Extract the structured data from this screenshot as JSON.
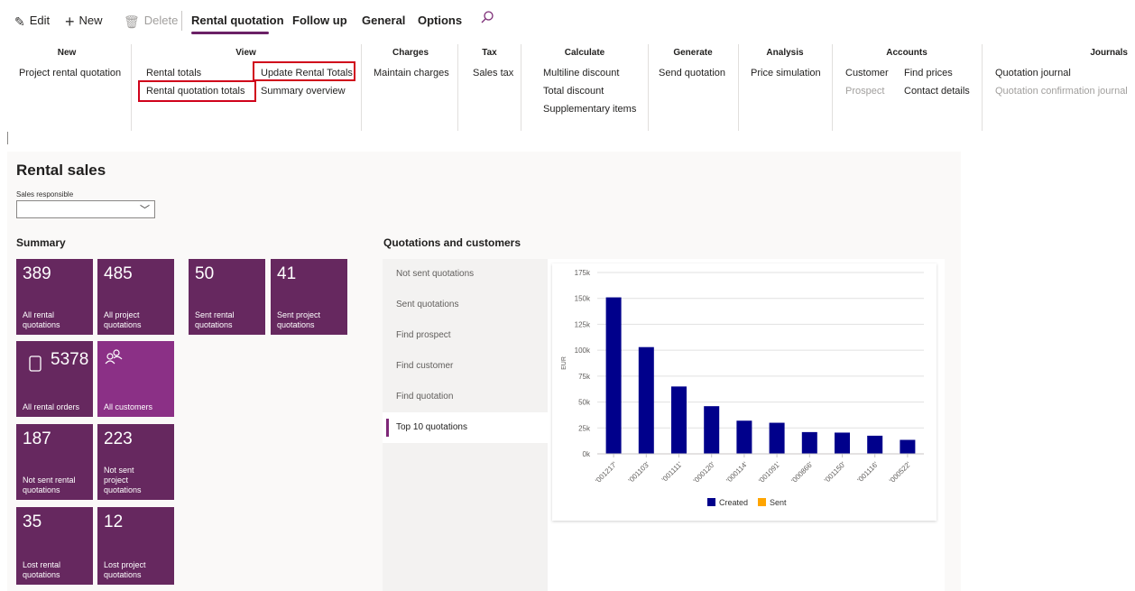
{
  "toolbar": {
    "edit_label": "Edit",
    "new_label": "New",
    "delete_label": "Delete",
    "tabs": [
      "Rental quotation",
      "Follow up",
      "General",
      "Options"
    ],
    "active_tab": "Rental quotation",
    "accent": "#6b2166"
  },
  "ribbon": {
    "new": {
      "header": "New",
      "items": [
        "Project rental quotation"
      ]
    },
    "view": {
      "header": "View",
      "items": [
        "Rental totals",
        "Rental quotation totals",
        "Update Rental Totals",
        "Summary overview"
      ]
    },
    "charges": {
      "header": "Charges",
      "items": [
        "Maintain charges"
      ]
    },
    "tax": {
      "header": "Tax",
      "items": [
        "Sales tax"
      ]
    },
    "calculate": {
      "header": "Calculate",
      "items": [
        "Multiline discount",
        "Total discount",
        "Supplementary items"
      ]
    },
    "generate": {
      "header": "Generate",
      "items": [
        "Send quotation"
      ]
    },
    "analysis": {
      "header": "Analysis",
      "items": [
        "Price simulation"
      ]
    },
    "accounts": {
      "header": "Accounts",
      "items": [
        "Customer",
        "Prospect",
        "Find prices",
        "Contact details"
      ]
    },
    "journals": {
      "header": "Journals",
      "items": [
        "Quotation journal",
        "Quotation confirmation journal"
      ]
    }
  },
  "workspace": {
    "title": "Rental sales",
    "sales_responsible_label": "Sales responsible",
    "sales_responsible_value": "",
    "summary_title": "Summary",
    "quotations_title": "Quotations and customers",
    "tiles": [
      {
        "count": "389",
        "label": "All rental quotations"
      },
      {
        "count": "485",
        "label": "All project quotations"
      },
      {
        "count": "50",
        "label": "Sent rental quotations"
      },
      {
        "count": "41",
        "label": "Sent project quotations"
      },
      {
        "count": "5378",
        "label": "All rental orders"
      },
      {
        "count": "",
        "label": "All customers"
      },
      {
        "count": "187",
        "label": "Not sent rental quotations"
      },
      {
        "count": "223",
        "label": "Not sent project quotations"
      },
      {
        "count": "35",
        "label": "Lost rental quotations"
      },
      {
        "count": "12",
        "label": "Lost project quotations"
      }
    ],
    "tile_color": "#66285f",
    "tile_highlight_color": "#8b3086",
    "quotation_views": [
      "Not sent quotations",
      "Sent quotations",
      "Find prospect",
      "Find customer",
      "Find quotation",
      "Top 10 quotations"
    ],
    "selected_view": "Top 10 quotations"
  },
  "chart_data": {
    "type": "bar",
    "ylabel": "EUR",
    "ylim": [
      0,
      175000
    ],
    "yticks": [
      "0k",
      "25k",
      "50k",
      "75k",
      "100k",
      "125k",
      "150k",
      "175k"
    ],
    "grid": true,
    "legend_position": "bottom",
    "categories": [
      "'001217'",
      "'001103'",
      "'001111'",
      "'000120'",
      "'000114'",
      "'001091'",
      "'000866'",
      "'001150'",
      "'001116'",
      "'000522'"
    ],
    "series": [
      {
        "name": "Created",
        "color": "#00008b",
        "values": [
          151000,
          103000,
          65000,
          46000,
          32000,
          30000,
          21000,
          20500,
          17500,
          13500
        ]
      },
      {
        "name": "Sent",
        "color": "#ffa500",
        "values": [
          0,
          0,
          0,
          0,
          0,
          0,
          0,
          0,
          0,
          0
        ]
      }
    ]
  }
}
